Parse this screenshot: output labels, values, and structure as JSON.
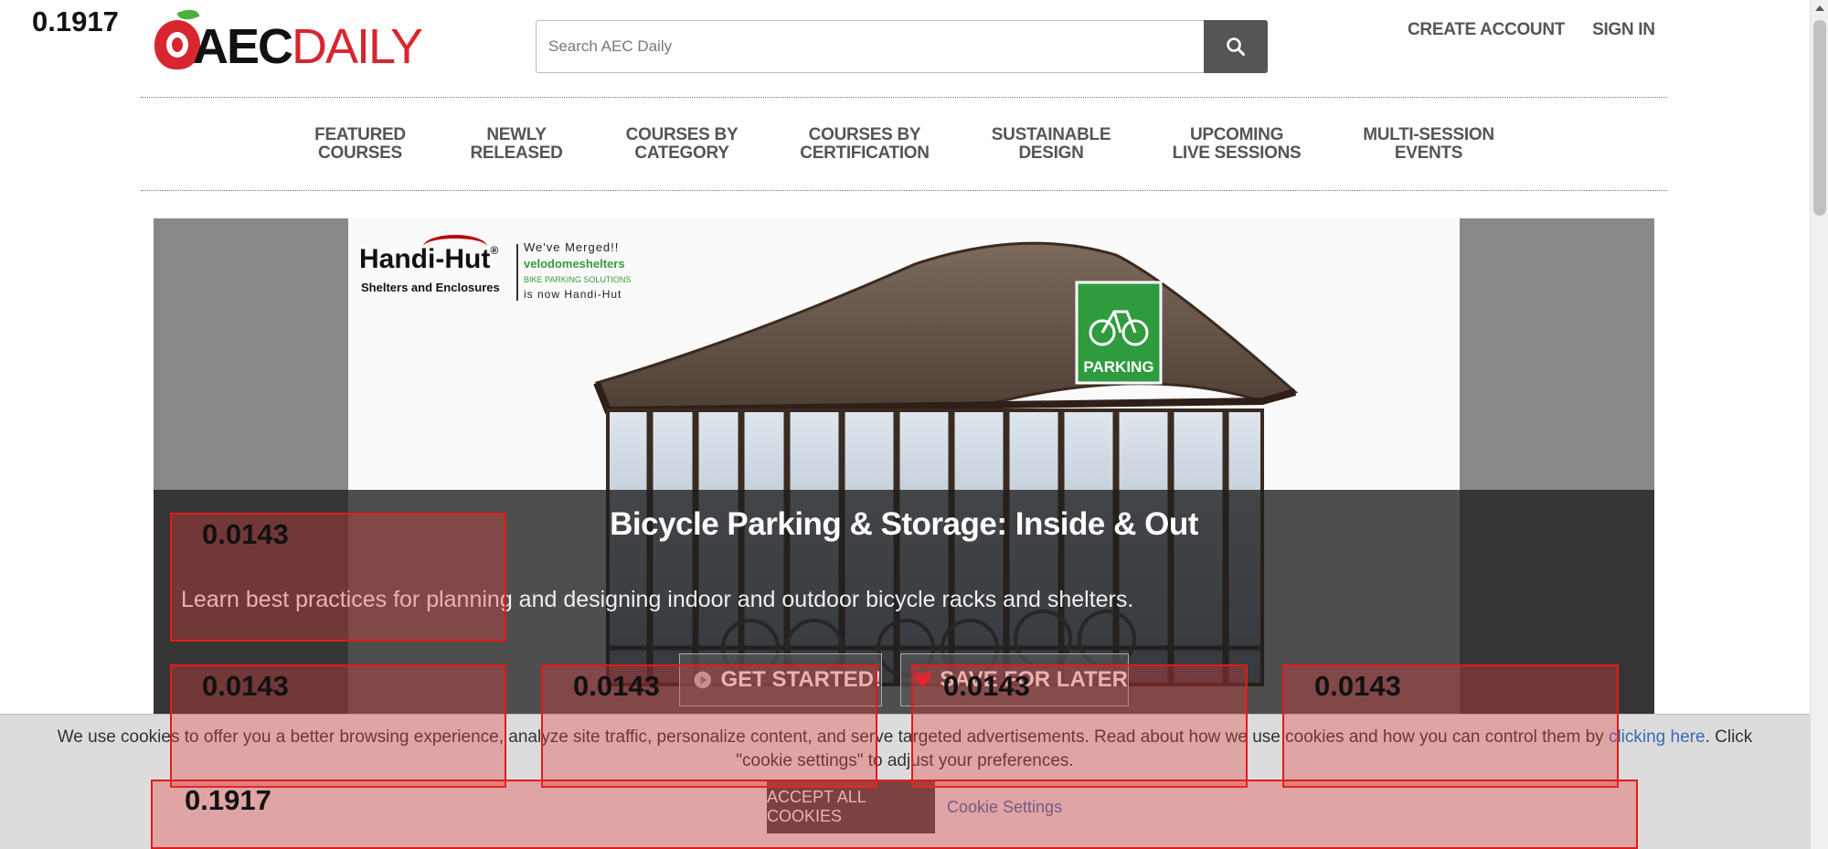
{
  "annotations": {
    "top_score": "0.1917",
    "box_scores": [
      "0.0143",
      "0.0143",
      "0.0143",
      "0.0143",
      "0.0143",
      "0.1917"
    ]
  },
  "logo": {
    "prefix": "@",
    "aec": "AEC",
    "daily": "DAILY"
  },
  "search": {
    "placeholder": "Search AEC Daily",
    "value": ""
  },
  "header_links": {
    "create_account": "CREATE ACCOUNT",
    "sign_in": "SIGN IN"
  },
  "nav": [
    {
      "label": "FEATURED\nCOURSES"
    },
    {
      "label": "NEWLY\nRELEASED"
    },
    {
      "label": "COURSES BY\nCATEGORY"
    },
    {
      "label": "COURSES BY\nCERTIFICATION"
    },
    {
      "label": "SUSTAINABLE\nDESIGN"
    },
    {
      "label": "UPCOMING\nLIVE SESSIONS"
    },
    {
      "label": "MULTI-SESSION\nEVENTS"
    }
  ],
  "hero": {
    "brand": "Handi-Hut",
    "brand_reg": "®",
    "brand_sub": "Shelters and Enclosures",
    "merged": "We've Merged!!",
    "velo": "velodomeshelters",
    "velo_sub": "BIKE PARKING SOLUTIONS",
    "now": "is now Handi-Hut",
    "sign": "PARKING",
    "title": "Bicycle Parking & Storage: Inside & Out",
    "description": "Learn best practices for planning and designing indoor and outdoor bicycle racks and shelters.",
    "get_started": "GET STARTED!",
    "save_later": "SAVE FOR LATER"
  },
  "cookie": {
    "glyph": "",
    "text_before": "We use cookies to offer you a better browsing experience, analyze site traffic, personalize content, and serve targeted advertisements. Read about how we use cookies and how you can control them by ",
    "link": "clicking here",
    "text_after": ". Click \"cookie settings\" to adjust your preferences.",
    "accept": "ACCEPT ALL COOKIES",
    "settings": "Cookie Settings"
  },
  "colors": {
    "brand_red": "#d7262e",
    "accent_green": "#4caf3b",
    "link_blue": "#3c6bb0",
    "annotation_red": "#e21b1b"
  }
}
